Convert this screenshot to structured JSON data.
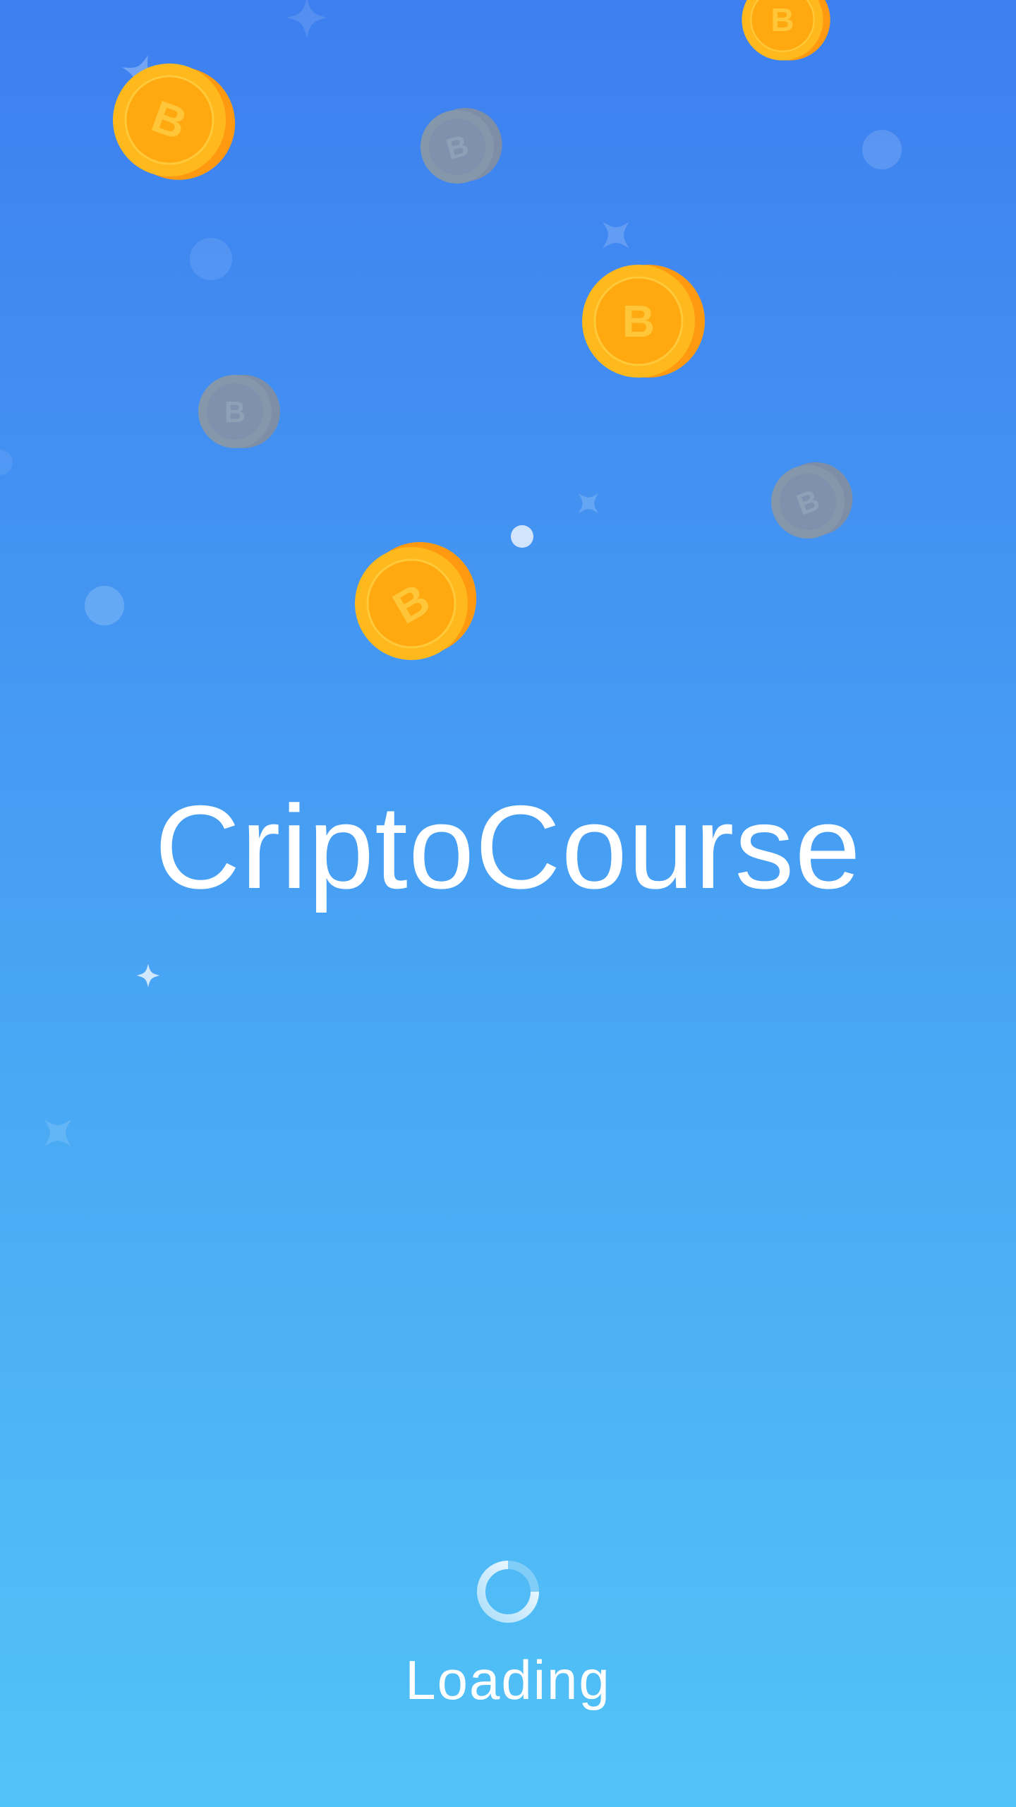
{
  "app": {
    "title": "CriptoCourse"
  },
  "status": {
    "label": "Loading",
    "spinner_icon": "loading-spinner-icon"
  },
  "background": {
    "decorations": [
      "bitcoin-coin-icon",
      "sparkle-icon",
      "bubble-icon"
    ]
  },
  "colors": {
    "gradient_top": "#3D80F0",
    "gradient_bottom": "#52C3F7",
    "coin_face": "#FFB91D",
    "coin_rim": "#FF9A10",
    "coin_faded": "#8597A8",
    "text": "#FFFFFF"
  }
}
